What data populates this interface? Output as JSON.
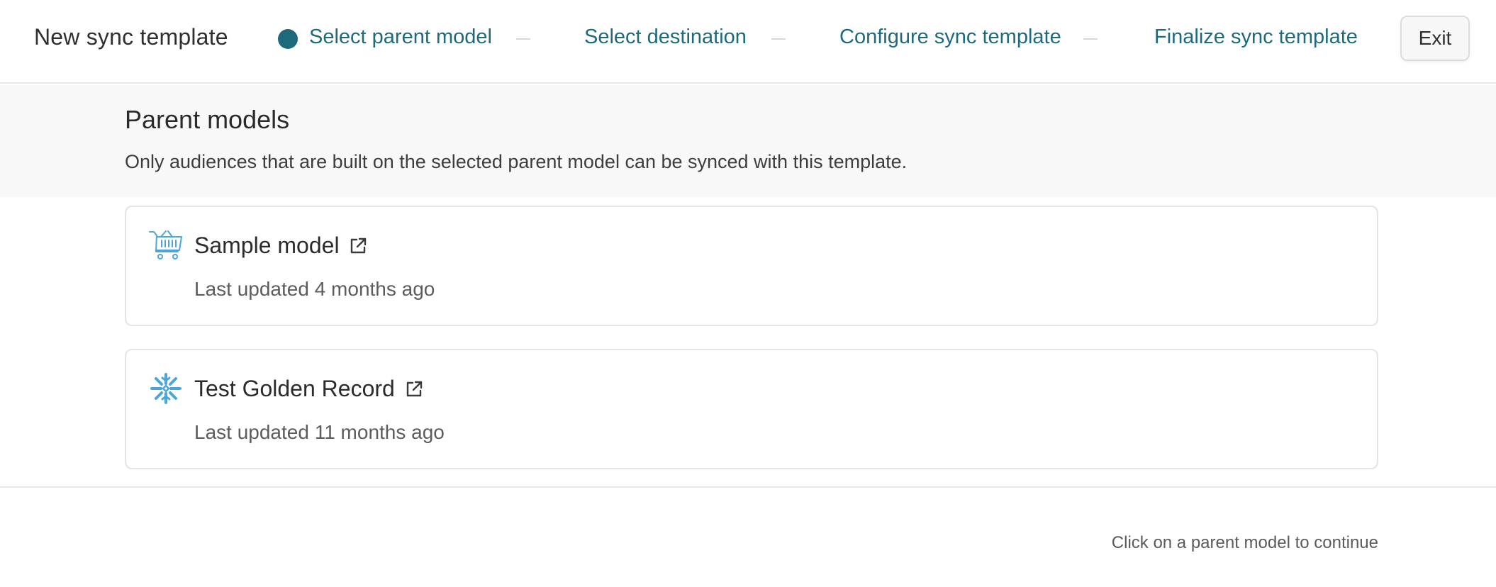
{
  "header": {
    "title": "New sync template",
    "steps": [
      {
        "label": "Select parent model",
        "active": true
      },
      {
        "label": "Select destination",
        "active": false
      },
      {
        "label": "Configure sync template",
        "active": false
      },
      {
        "label": "Finalize sync template",
        "active": false
      }
    ],
    "exit_label": "Exit"
  },
  "section": {
    "title": "Parent models",
    "description": "Only audiences that are built on the selected parent model can be synced with this template."
  },
  "models": [
    {
      "name": "Sample model",
      "updated": "Last updated 4 months ago",
      "icon": "shopping-cart-icon"
    },
    {
      "name": "Test Golden Record",
      "updated": "Last updated 11 months ago",
      "icon": "snowflake-icon"
    }
  ],
  "footer": {
    "hint": "Click on a parent model to continue"
  },
  "colors": {
    "accent": "#1d6a7c",
    "icon_blue": "#4ba6d8",
    "intro_bg": "#f8f8f8"
  }
}
